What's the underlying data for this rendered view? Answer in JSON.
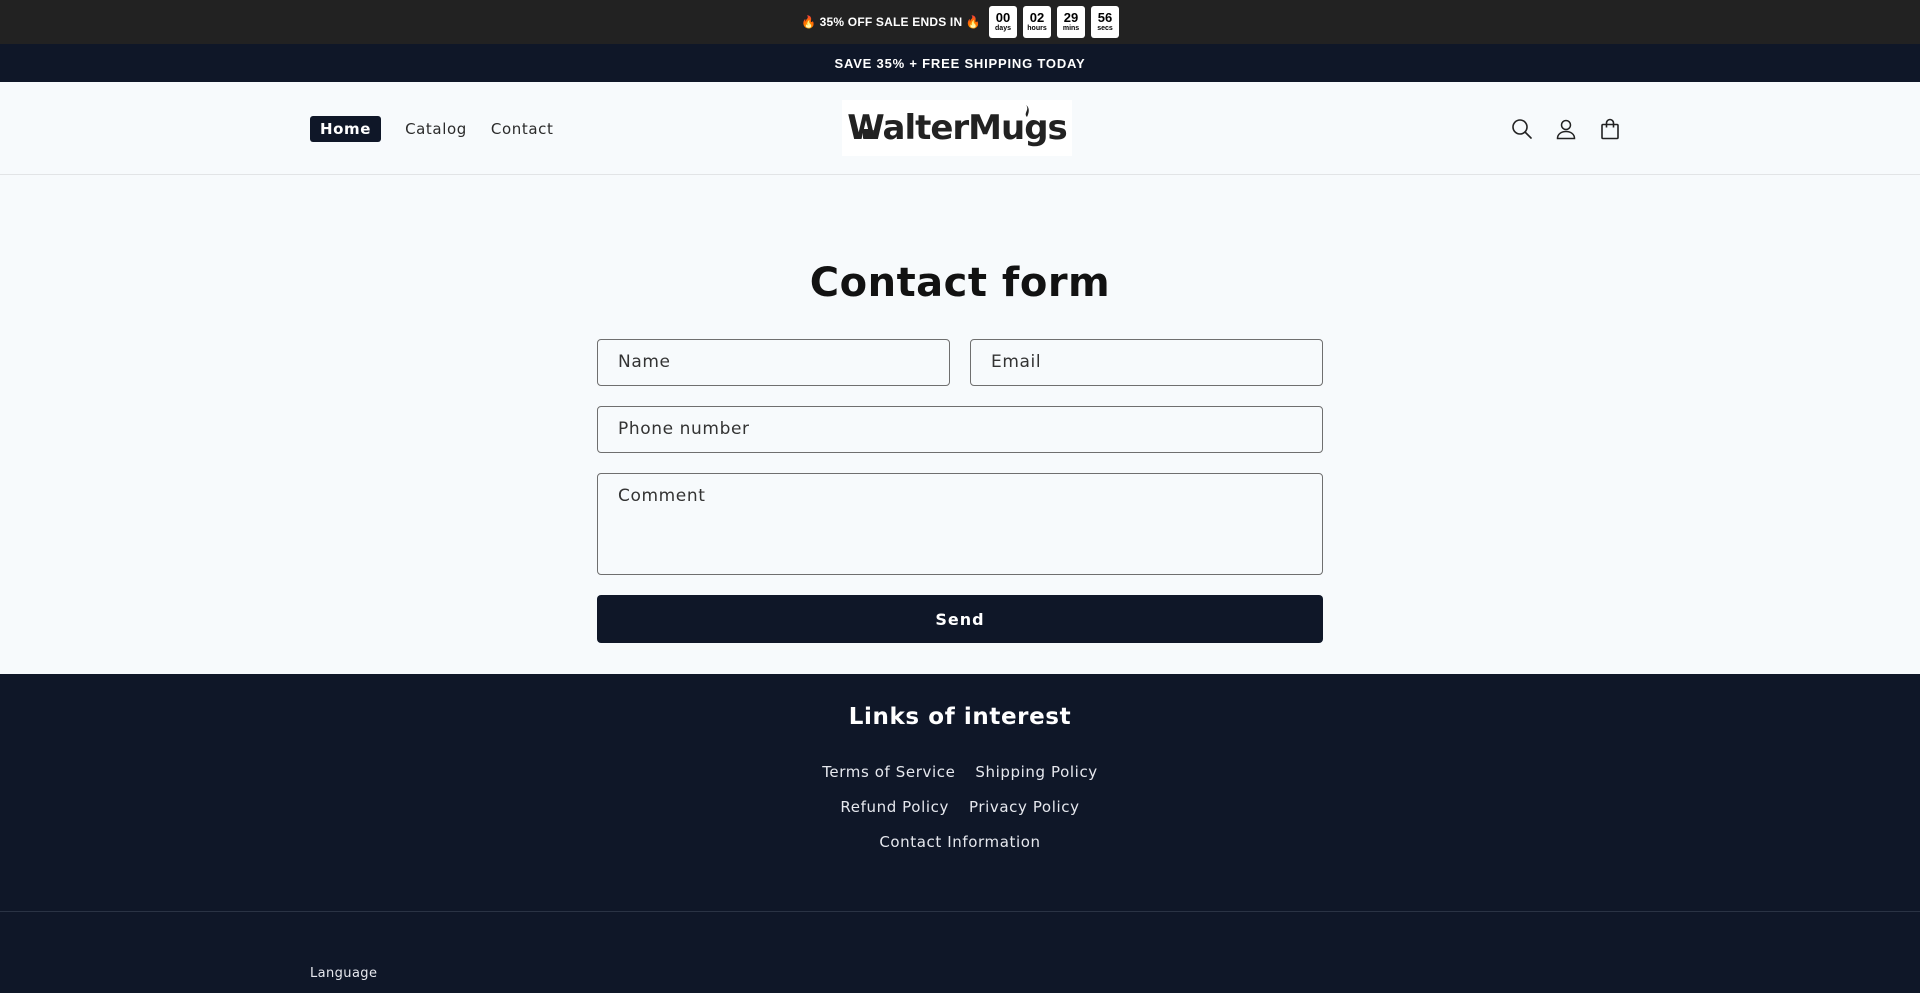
{
  "countdown": {
    "text": "🔥 35% OFF SALE ENDS IN 🔥",
    "units": [
      {
        "value": "00",
        "label": "days"
      },
      {
        "value": "02",
        "label": "hours"
      },
      {
        "value": "29",
        "label": "mins"
      },
      {
        "value": "56",
        "label": "secs"
      }
    ]
  },
  "announcement": "SAVE 35% + FREE SHIPPING TODAY",
  "header": {
    "nav": [
      {
        "label": "Home"
      },
      {
        "label": "Catalog"
      },
      {
        "label": "Contact"
      }
    ],
    "logo_text": "WalterMugs",
    "icons": [
      "search-icon",
      "account-icon",
      "cart-icon"
    ]
  },
  "form": {
    "title": "Contact form",
    "name_label": "Name",
    "email_label": "Email",
    "phone_label": "Phone number",
    "comment_label": "Comment",
    "send_label": "Send"
  },
  "footer": {
    "title": "Links of interest",
    "links": {
      "terms": "Terms of Service",
      "shipping": "Shipping Policy",
      "refund": "Refund Policy",
      "privacy": "Privacy Policy",
      "contact": "Contact Information"
    },
    "language_label": "Language"
  },
  "colors": {
    "dark_navy": "#0f1728",
    "countdown_bg": "#222222",
    "page_bg": "#f7fafc"
  }
}
